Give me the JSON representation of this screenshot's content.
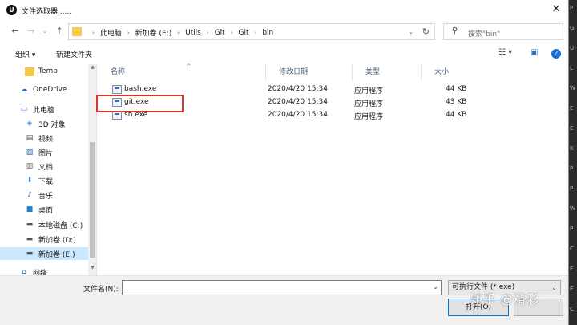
{
  "window": {
    "title": "文件选取器......",
    "app_icon": "unreal-logo-icon"
  },
  "address": {
    "crumbs": [
      "此电脑",
      "新加卷 (E:)",
      "Utils",
      "Git",
      "Git",
      "bin"
    ]
  },
  "search": {
    "placeholder": "搜索\"bin\""
  },
  "toolbar": {
    "organize": "组织 ▾",
    "new_folder": "新建文件夹"
  },
  "sidebar": {
    "items": [
      {
        "label": "Temp",
        "icon": "folder-icon"
      },
      {
        "label": "OneDrive",
        "icon": "cloud-icon"
      },
      {
        "label": "此电脑",
        "icon": "computer-icon"
      },
      {
        "label": "3D 对象",
        "icon": "cube-icon"
      },
      {
        "label": "视频",
        "icon": "video-icon"
      },
      {
        "label": "图片",
        "icon": "picture-icon"
      },
      {
        "label": "文档",
        "icon": "document-icon"
      },
      {
        "label": "下载",
        "icon": "download-icon"
      },
      {
        "label": "音乐",
        "icon": "music-icon"
      },
      {
        "label": "桌面",
        "icon": "desktop-icon"
      },
      {
        "label": "本地磁盘 (C:)",
        "icon": "drive-icon"
      },
      {
        "label": "新加卷 (D:)",
        "icon": "drive-icon"
      },
      {
        "label": "新加卷 (E:)",
        "icon": "drive-icon"
      },
      {
        "label": "网络",
        "icon": "network-icon"
      }
    ]
  },
  "columns": {
    "name": "名称",
    "date": "修改日期",
    "type": "类型",
    "size": "大小"
  },
  "files": [
    {
      "name": "bash.exe",
      "date": "2020/4/20 15:34",
      "type": "应用程序",
      "size": "44 KB"
    },
    {
      "name": "git.exe",
      "date": "2020/4/20 15:34",
      "type": "应用程序",
      "size": "43 KB"
    },
    {
      "name": "sh.exe",
      "date": "2020/4/20 15:34",
      "type": "应用程序",
      "size": "44 KB"
    }
  ],
  "bottom": {
    "filename_label": "文件名(N):",
    "filename_value": "",
    "filetype": "可执行文件 (*.exe)",
    "open_label": "打开(O)"
  },
  "watermark": "知乎 @精彩",
  "background_letters": [
    "P",
    "G",
    "U",
    "L",
    "W",
    "E",
    "E",
    "K",
    "P",
    "P",
    "W",
    "P",
    "C",
    "E",
    "E",
    "C"
  ],
  "colors": {
    "selection": "#cce8ff",
    "highlight_box": "#d9352f",
    "folder": "#f3c94d"
  }
}
